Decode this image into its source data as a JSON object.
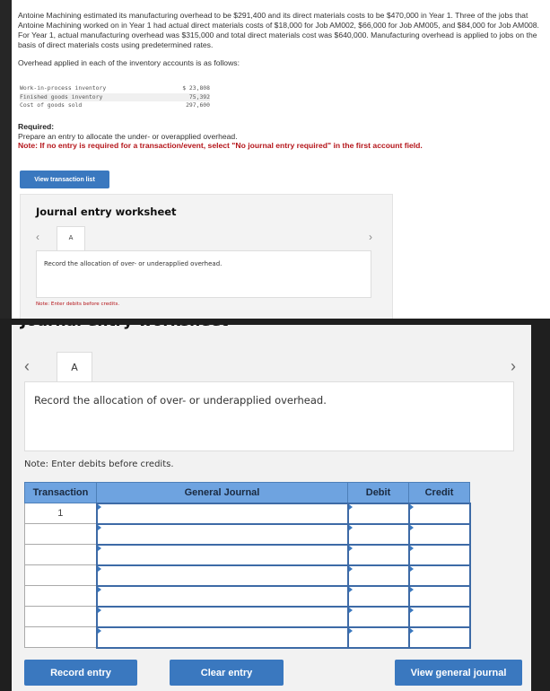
{
  "problem": {
    "paragraph": "Antoine Machining estimated its manufacturing overhead to be $291,400 and its direct materials costs to be $470,000 in Year 1. Three of the jobs that Antoine Machining worked on in Year 1 had actual direct materials costs of $18,000 for Job AM002, $66,000 for Job AM005, and $84,000 for Job AM008. For Year 1, actual manufacturing overhead was $315,000 and total direct materials cost was $640,000. Manufacturing overhead is applied to jobs on the basis of direct materials costs using predetermined rates.",
    "overhead_intro": "Overhead applied in each of the inventory accounts is as follows:",
    "overhead_table": [
      {
        "account": "Work-in-process inventory",
        "amount": "$ 23,808"
      },
      {
        "account": "Finished goods inventory",
        "amount": "75,392"
      },
      {
        "account": "Cost of goods sold",
        "amount": "297,600"
      }
    ],
    "required_label": "Required:",
    "required_text": "Prepare an entry to allocate the under- or overapplied overhead.",
    "required_note": "Note: If no entry is required for a transaction/event, select \"No journal entry required\" in the first account field."
  },
  "view_transaction_list": "View transaction list",
  "worksheet": {
    "title": "Journal entry worksheet",
    "tab": "A",
    "description": "Record the allocation of over- or underapplied overhead.",
    "note": "Note: Enter debits before credits.",
    "columns": [
      "Transaction",
      "General Journal",
      "Debit",
      "Credit"
    ],
    "rows": [
      {
        "transaction": "1",
        "account": "",
        "debit": "",
        "credit": ""
      },
      {
        "transaction": "",
        "account": "",
        "debit": "",
        "credit": ""
      },
      {
        "transaction": "",
        "account": "",
        "debit": "",
        "credit": ""
      },
      {
        "transaction": "",
        "account": "",
        "debit": "",
        "credit": ""
      },
      {
        "transaction": "",
        "account": "",
        "debit": "",
        "credit": ""
      },
      {
        "transaction": "",
        "account": "",
        "debit": "",
        "credit": ""
      },
      {
        "transaction": "",
        "account": "",
        "debit": "",
        "credit": ""
      }
    ],
    "buttons": {
      "record": "Record entry",
      "clear": "Clear entry",
      "view_journal": "View general journal"
    }
  },
  "colors": {
    "button": "#3a78bf",
    "header": "#6ea3e0",
    "note": "#b5161b"
  }
}
